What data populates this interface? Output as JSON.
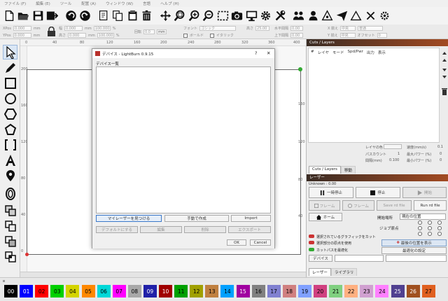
{
  "menu": [
    "ファイル (F)",
    "編集 (E)",
    "ツール",
    "配置 (A)",
    "ウィンドウ (W)",
    "言語",
    "ヘルプ (H)"
  ],
  "props": {
    "xpos_label": "XPos",
    "xpos_val": "0.000",
    "ypos_label": "YPos",
    "ypos_val": "0.000",
    "unit_mm": "mm",
    "width_label": "幅",
    "width_val": "0.000",
    "height_label": "高さ",
    "height_val": "0.000",
    "pct_a": "100.000",
    "pct_b": "100.000",
    "pct_sym": "%",
    "rotate_label": "回転",
    "rotate_val": "0.0",
    "mm_btn": "mm",
    "font_label": "フォント",
    "font_val": "ゴシック",
    "bold": "ボールド",
    "italic": "イタリック",
    "hsize_label": "高さ",
    "hsize_val": "25.00",
    "hspace_label": "水平間隔",
    "hspace_val": "0.00",
    "vspace_label": "上下間隔",
    "vspace_val": "0.00",
    "align_x_label": "X 揃え",
    "align_x_val": "中央",
    "align_y_label": "Y 揃え",
    "align_y_val": "中央",
    "normal_val": "普通",
    "offset_label": "オフセット",
    "offset_val": "0"
  },
  "ruler": {
    "top": [
      "0",
      "40",
      "80",
      "120",
      "160",
      "200",
      "240",
      "280",
      "320",
      "360",
      "400"
    ],
    "left": [
      "0",
      "40",
      "80",
      "120",
      "160",
      "200",
      "240",
      "280"
    ],
    "right": [
      "280",
      "240",
      "200",
      "160",
      "120",
      "80",
      "40"
    ]
  },
  "cuts": {
    "title": "Cuts / Layers",
    "cols": [
      "#",
      "レイヤ",
      "モード",
      "Spd/Pwr",
      "出力",
      "表示"
    ],
    "layer_color": "レイヤの色",
    "passes": "パスカウント",
    "passes_val": "1",
    "interval": "間隔(mm)",
    "interval_val": "0.100",
    "speed": "速度(mm/s)",
    "speed_val": "0.1",
    "maxpower": "最大パワー (%)",
    "maxpower_val": "0",
    "minpower": "最小パワー (%)",
    "minpower_val": "0"
  },
  "tabs": {
    "cuts": "Cuts / Layers",
    "move": "移動",
    "laser": "レーザー",
    "library": "ライブラリ"
  },
  "laser": {
    "title": "レーザー",
    "status": "Unknown : 0.00",
    "pause": "一時停止",
    "stop": "停止",
    "start": "開始",
    "frame1": "フレーム",
    "frame2": "フレーム",
    "save_rd": "Save rd file",
    "run_rd": "Run rd file",
    "home": "ホーム",
    "start_from_label": "開始場所",
    "start_from_val": "現在の位置",
    "job_origin": "ジョブ原点",
    "cut_selected": "選択されているグラフィックをカット",
    "use_origin": "選択部分の原点を使用",
    "optimize": "カットパスを最適化",
    "show_last": "最後の位置を表示",
    "opt_settings": "最適化の設定",
    "devices": "デバイス"
  },
  "dialog": {
    "title": "デバイス - LightBurn 0.9.15",
    "list_label": "デバイス一覧",
    "help": "?",
    "close": "✕",
    "find_btn": "マイレーザーを見つける",
    "manual_btn": "手動で作成",
    "import_btn": "Import",
    "default_btn": "デフォルトにする",
    "edit_btn": "編集",
    "delete_btn": "削除",
    "export_btn": "エクスポート",
    "ok_btn": "OK",
    "cancel_btn": "Cancel"
  },
  "palette": [
    {
      "label": "00",
      "color": "#000000",
      "text": "#ffffff"
    },
    {
      "label": "01",
      "color": "#0000ff",
      "text": "#ffffff"
    },
    {
      "label": "02",
      "color": "#ff0000",
      "text": "#000000"
    },
    {
      "label": "03",
      "color": "#00d000",
      "text": "#000000"
    },
    {
      "label": "04",
      "color": "#d4d400",
      "text": "#000000"
    },
    {
      "label": "05",
      "color": "#ff8800",
      "text": "#000000"
    },
    {
      "label": "06",
      "color": "#00d8d8",
      "text": "#000000"
    },
    {
      "label": "07",
      "color": "#ff00ff",
      "text": "#000000"
    },
    {
      "label": "08",
      "color": "#a8a8a8",
      "text": "#000000"
    },
    {
      "label": "09",
      "color": "#2020a8",
      "text": "#ffffff"
    },
    {
      "label": "10",
      "color": "#a00000",
      "text": "#ffffff"
    },
    {
      "label": "11",
      "color": "#00a000",
      "text": "#000000"
    },
    {
      "label": "12",
      "color": "#a0a000",
      "text": "#000000"
    },
    {
      "label": "13",
      "color": "#c08040",
      "text": "#000000"
    },
    {
      "label": "14",
      "color": "#00a0ff",
      "text": "#000000"
    },
    {
      "label": "15",
      "color": "#a000a0",
      "text": "#ffffff"
    },
    {
      "label": "16",
      "color": "#808080",
      "text": "#000000"
    },
    {
      "label": "17",
      "color": "#8080d0",
      "text": "#000000"
    },
    {
      "label": "18",
      "color": "#d08080",
      "text": "#000000"
    },
    {
      "label": "19",
      "color": "#80a0ff",
      "text": "#000000"
    },
    {
      "label": "20",
      "color": "#d04080",
      "text": "#000000"
    },
    {
      "label": "21",
      "color": "#80d080",
      "text": "#000000"
    },
    {
      "label": "22",
      "color": "#ffb080",
      "text": "#000000"
    },
    {
      "label": "23",
      "color": "#d0a0d0",
      "text": "#000000"
    },
    {
      "label": "24",
      "color": "#ff80ff",
      "text": "#000000"
    },
    {
      "label": "25",
      "color": "#504090",
      "text": "#ffffff"
    },
    {
      "label": "26",
      "color": "#a05020",
      "text": "#ffffff"
    },
    {
      "label": "27",
      "color": "#e06020",
      "text": "#000000"
    }
  ]
}
